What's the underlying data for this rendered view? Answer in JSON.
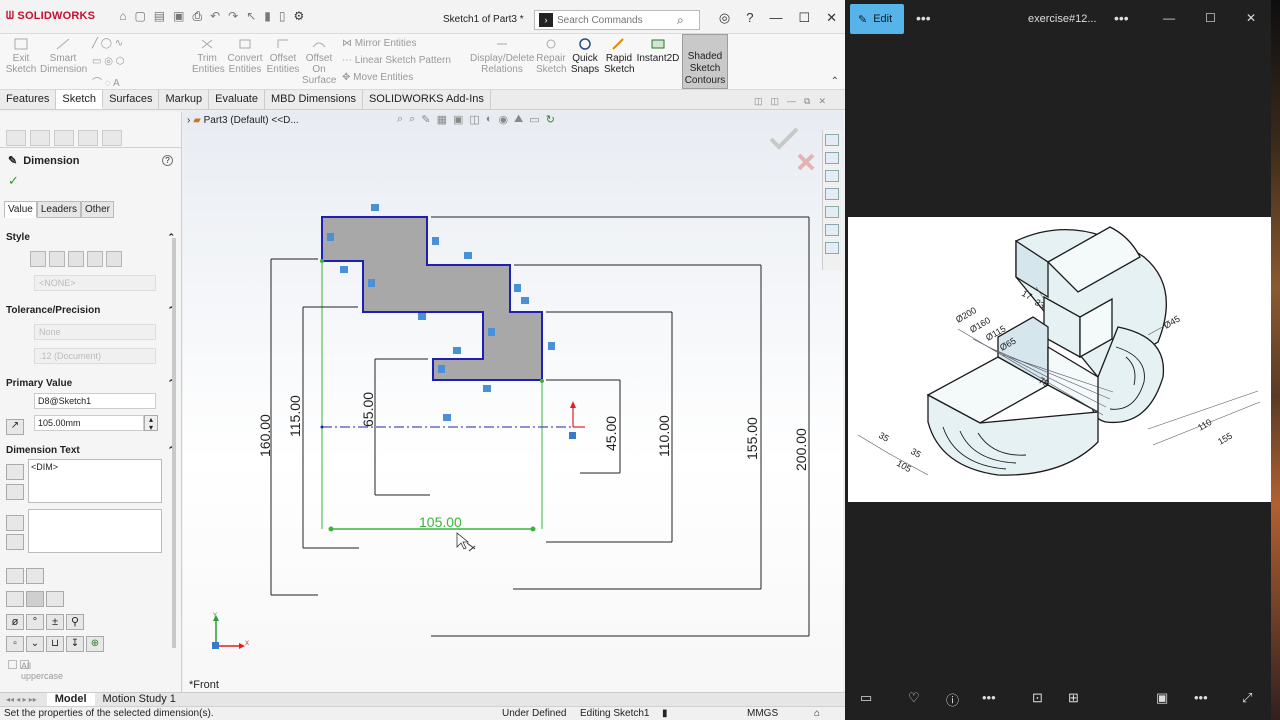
{
  "app": {
    "logo": "SOLIDWORKS",
    "doc_title": "Sketch1 of Part3 *",
    "search_placeholder": "Search Commands"
  },
  "ribbon": {
    "exit_sketch": "Exit Sketch",
    "smart_dimension": "Smart Dimension",
    "trim_entities": "Trim Entities",
    "convert_entities": "Convert Entities",
    "offset_entities": "Offset Entities",
    "offset_on_surface": "Offset On Surface",
    "mirror_entities": "Mirror Entities",
    "linear_sketch_pattern": "Linear Sketch Pattern",
    "move_entities": "Move Entities",
    "display_delete_relations": "Display/Delete Relations",
    "repair_sketch": "Repair Sketch",
    "quick_snaps": "Quick Snaps",
    "rapid_sketch": "Rapid Sketch",
    "instant2d": "Instant2D",
    "shaded_sketch_contours": "Shaded Sketch Contours"
  },
  "tabs": [
    "Features",
    "Sketch",
    "Surfaces",
    "Markup",
    "Evaluate",
    "MBD Dimensions",
    "SOLIDWORKS Add-Ins"
  ],
  "active_tab": "Sketch",
  "property_manager": {
    "title": "Dimension",
    "subtabs": [
      "Value",
      "Leaders",
      "Other"
    ],
    "style_label": "Style",
    "style_dropdown": "<NONE>",
    "tolerance_label": "Tolerance/Precision",
    "tolerance_value": "None",
    "precision_value": ".12 (Document)",
    "primary_value_label": "Primary Value",
    "primary_name": "D8@Sketch1",
    "primary_value": "105.00mm",
    "dimension_text_label": "Dimension Text",
    "dimension_text": "<DIM>",
    "all_uppercase": "All uppercase"
  },
  "graphics": {
    "tree_label": "Part3 (Default) <<D...",
    "view_label": "*Front",
    "dims": {
      "d160": "160.00",
      "d115": "115.00",
      "d65": "65.00",
      "d105": "105.00",
      "d45": "45.00",
      "d110": "110.00",
      "d155": "155.00",
      "d200": "200.00"
    }
  },
  "bottom_tabs": [
    "Model",
    "Motion Study 1"
  ],
  "status": {
    "message": "Set the properties of the selected dimension(s).",
    "state": "Under Defined",
    "editing": "Editing Sketch1",
    "units": "MMGS"
  },
  "viewer": {
    "edit_label": "Edit",
    "title": "exercise#12..."
  },
  "colors": {
    "accent_blue": "#57b4e8",
    "sketch_blue": "#1f1fb5",
    "selected_green": "#3cb43c",
    "logo_red": "#c8102e"
  }
}
